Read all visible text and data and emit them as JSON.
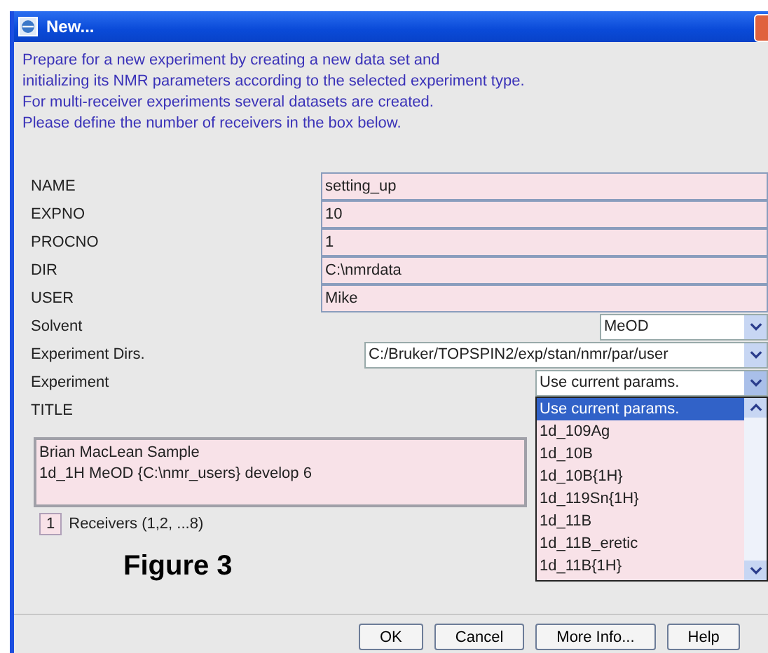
{
  "window": {
    "title": "New..."
  },
  "intro": [
    "Prepare for a new experiment by creating a new data set and",
    "initializing its NMR parameters according to the selected experiment type.",
    "For multi-receiver experiments several datasets are created.",
    "Please define the number of receivers in the box below."
  ],
  "fields": [
    {
      "label": "NAME",
      "value": "setting_up",
      "kind": "text"
    },
    {
      "label": "EXPNO",
      "value": "10",
      "kind": "text"
    },
    {
      "label": "PROCNO",
      "value": "1",
      "kind": "text"
    },
    {
      "label": "DIR",
      "value": "C:\\nmrdata",
      "kind": "text"
    },
    {
      "label": "USER",
      "value": "Mike",
      "kind": "text"
    },
    {
      "label": "Solvent",
      "value": "MeOD",
      "kind": "combo"
    },
    {
      "label": "Experiment Dirs.",
      "value": "C:/Bruker/TOPSPIN2/exp/stan/nmr/par/user",
      "kind": "combo"
    },
    {
      "label": "Experiment",
      "value": "Use current params.",
      "kind": "combo",
      "expanded": true,
      "options": [
        {
          "label": "Use current params.",
          "selected": true
        },
        {
          "label": "1d_109Ag",
          "selected": false
        },
        {
          "label": "1d_10B",
          "selected": false
        },
        {
          "label": "1d_10B{1H}",
          "selected": false
        },
        {
          "label": "1d_119Sn{1H}",
          "selected": false
        },
        {
          "label": "1d_11B",
          "selected": false
        },
        {
          "label": "1d_11B_eretic",
          "selected": false
        },
        {
          "label": "1d_11B{1H}",
          "selected": false
        }
      ]
    }
  ],
  "title_field": {
    "label": "TITLE",
    "lines": [
      "Brian MacLean Sample",
      "1d_1H MeOD {C:\\nmr_users} develop 6"
    ]
  },
  "receivers": {
    "value": "1",
    "label": "Receivers (1,2, ...8)"
  },
  "caption": "Figure 3",
  "buttons": [
    "OK",
    "Cancel",
    "More Info...",
    "Help"
  ]
}
